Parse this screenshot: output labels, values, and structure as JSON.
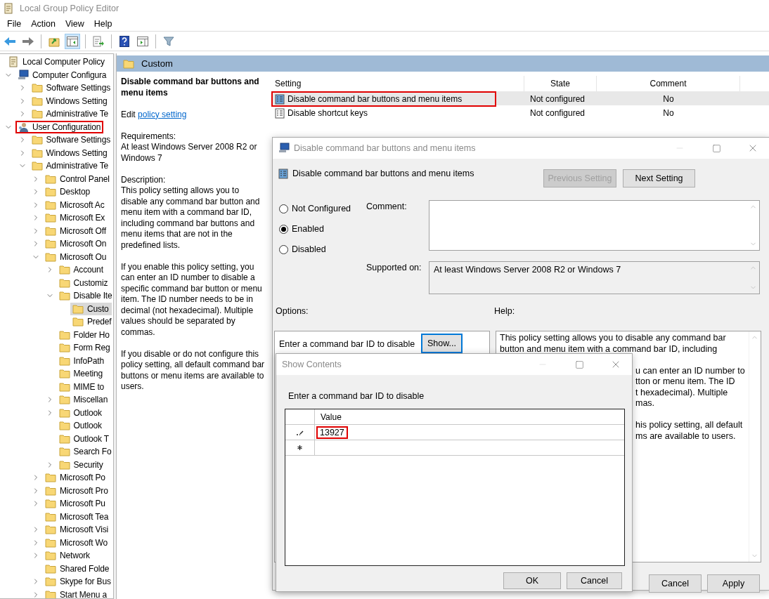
{
  "window": {
    "title": "Local Group Policy Editor"
  },
  "menu": [
    "File",
    "Action",
    "View",
    "Help"
  ],
  "toolbar": [
    {
      "kind": "back",
      "pressed": false
    },
    {
      "kind": "forward",
      "pressed": false
    },
    {
      "kind": "separator"
    },
    {
      "kind": "up",
      "pressed": false
    },
    {
      "kind": "tree",
      "pressed": true
    },
    {
      "kind": "separator"
    },
    {
      "kind": "export",
      "pressed": false
    },
    {
      "kind": "separator"
    },
    {
      "kind": "help",
      "pressed": false
    },
    {
      "kind": "properties",
      "pressed": false
    },
    {
      "kind": "separator"
    },
    {
      "kind": "filter",
      "pressed": false
    }
  ],
  "tree": [
    {
      "label": "Local Computer Policy",
      "kind": "policy",
      "selected": false,
      "highlighted": false,
      "children": [
        {
          "label": "Computer Configura",
          "kind": "computer",
          "expandable": true,
          "expanded": true,
          "selected": false,
          "highlighted": false,
          "children": [
            {
              "label": "Software Settings",
              "kind": "folder",
              "expandable": true,
              "expanded": false,
              "selected": false,
              "highlighted": false
            },
            {
              "label": "Windows Setting",
              "kind": "folder",
              "expandable": true,
              "expanded": false,
              "selected": false,
              "highlighted": false
            },
            {
              "label": "Administrative Te",
              "kind": "folder",
              "expandable": true,
              "expanded": false,
              "selected": false,
              "highlighted": false
            }
          ]
        },
        {
          "label": "User Configuration",
          "kind": "user",
          "expandable": true,
          "expanded": true,
          "selected": false,
          "highlighted": true,
          "children": [
            {
              "label": "Software Settings",
              "kind": "folder",
              "expandable": true,
              "expanded": false,
              "selected": false,
              "highlighted": false
            },
            {
              "label": "Windows Setting",
              "kind": "folder",
              "expandable": true,
              "expanded": false,
              "selected": false,
              "highlighted": false
            },
            {
              "label": "Administrative Te",
              "kind": "folder",
              "expandable": true,
              "expanded": true,
              "selected": false,
              "highlighted": false,
              "children": [
                {
                  "label": "Control Panel",
                  "kind": "folder",
                  "expandable": true,
                  "expanded": false,
                  "selected": false,
                  "highlighted": false
                },
                {
                  "label": "Desktop",
                  "kind": "folder",
                  "expandable": true,
                  "expanded": false,
                  "selected": false,
                  "highlighted": false
                },
                {
                  "label": "Microsoft Ac",
                  "kind": "folder",
                  "expandable": true,
                  "expanded": false,
                  "selected": false,
                  "highlighted": false
                },
                {
                  "label": "Microsoft Ex",
                  "kind": "folder",
                  "expandable": true,
                  "expanded": false,
                  "selected": false,
                  "highlighted": false
                },
                {
                  "label": "Microsoft Off",
                  "kind": "folder",
                  "expandable": true,
                  "expanded": false,
                  "selected": false,
                  "highlighted": false
                },
                {
                  "label": "Microsoft On",
                  "kind": "folder",
                  "expandable": true,
                  "expanded": false,
                  "selected": false,
                  "highlighted": false
                },
                {
                  "label": "Microsoft Ou",
                  "kind": "folder",
                  "expandable": true,
                  "expanded": true,
                  "selected": false,
                  "highlighted": false,
                  "children": [
                    {
                      "label": "Account",
                      "kind": "folder",
                      "expandable": true,
                      "expanded": false,
                      "selected": false,
                      "highlighted": false
                    },
                    {
                      "label": "Customiz",
                      "kind": "folder",
                      "expandable": false,
                      "expanded": false,
                      "selected": false,
                      "highlighted": false
                    },
                    {
                      "label": "Disable Ite",
                      "kind": "folder",
                      "expandable": true,
                      "expanded": true,
                      "selected": false,
                      "highlighted": false,
                      "children": [
                        {
                          "label": "Custo",
                          "kind": "folder",
                          "expandable": false,
                          "expanded": false,
                          "selected": true,
                          "highlighted": false
                        },
                        {
                          "label": "Predef",
                          "kind": "folder",
                          "expandable": false,
                          "expanded": false,
                          "selected": false,
                          "highlighted": false
                        }
                      ]
                    },
                    {
                      "label": "Folder Ho",
                      "kind": "folder",
                      "expandable": false,
                      "expanded": false,
                      "selected": false,
                      "highlighted": false
                    },
                    {
                      "label": "Form Reg",
                      "kind": "folder",
                      "expandable": false,
                      "expanded": false,
                      "selected": false,
                      "highlighted": false
                    },
                    {
                      "label": "InfoPath",
                      "kind": "folder",
                      "expandable": false,
                      "expanded": false,
                      "selected": false,
                      "highlighted": false
                    },
                    {
                      "label": "Meeting",
                      "kind": "folder",
                      "expandable": false,
                      "expanded": false,
                      "selected": false,
                      "highlighted": false
                    },
                    {
                      "label": "MIME to",
                      "kind": "folder",
                      "expandable": false,
                      "expanded": false,
                      "selected": false,
                      "highlighted": false
                    },
                    {
                      "label": "Miscellan",
                      "kind": "folder",
                      "expandable": true,
                      "expanded": false,
                      "selected": false,
                      "highlighted": false
                    },
                    {
                      "label": "Outlook",
                      "kind": "folder",
                      "expandable": true,
                      "expanded": false,
                      "selected": false,
                      "highlighted": false
                    },
                    {
                      "label": "Outlook",
                      "kind": "folder",
                      "expandable": false,
                      "expanded": false,
                      "selected": false,
                      "highlighted": false
                    },
                    {
                      "label": "Outlook T",
                      "kind": "folder",
                      "expandable": false,
                      "expanded": false,
                      "selected": false,
                      "highlighted": false
                    },
                    {
                      "label": "Search Fo",
                      "kind": "folder",
                      "expandable": false,
                      "expanded": false,
                      "selected": false,
                      "highlighted": false
                    },
                    {
                      "label": "Security",
                      "kind": "folder",
                      "expandable": true,
                      "expanded": false,
                      "selected": false,
                      "highlighted": false
                    }
                  ]
                },
                {
                  "label": "Microsoft Po",
                  "kind": "folder",
                  "expandable": true,
                  "expanded": false,
                  "selected": false,
                  "highlighted": false
                },
                {
                  "label": "Microsoft Pro",
                  "kind": "folder",
                  "expandable": true,
                  "expanded": false,
                  "selected": false,
                  "highlighted": false
                },
                {
                  "label": "Microsoft Pu",
                  "kind": "folder",
                  "expandable": true,
                  "expanded": false,
                  "selected": false,
                  "highlighted": false
                },
                {
                  "label": "Microsoft Tea",
                  "kind": "folder",
                  "expandable": false,
                  "expanded": false,
                  "selected": false,
                  "highlighted": false
                },
                {
                  "label": "Microsoft Visi",
                  "kind": "folder",
                  "expandable": true,
                  "expanded": false,
                  "selected": false,
                  "highlighted": false
                },
                {
                  "label": "Microsoft Wo",
                  "kind": "folder",
                  "expandable": true,
                  "expanded": false,
                  "selected": false,
                  "highlighted": false
                },
                {
                  "label": "Network",
                  "kind": "folder",
                  "expandable": true,
                  "expanded": false,
                  "selected": false,
                  "highlighted": false
                },
                {
                  "label": "Shared Folde",
                  "kind": "folder",
                  "expandable": false,
                  "expanded": false,
                  "selected": false,
                  "highlighted": false
                },
                {
                  "label": "Skype for Bus",
                  "kind": "folder",
                  "expandable": true,
                  "expanded": false,
                  "selected": false,
                  "highlighted": false
                },
                {
                  "label": "Start Menu a",
                  "kind": "folder",
                  "expandable": true,
                  "expanded": false,
                  "selected": false,
                  "highlighted": false
                }
              ]
            }
          ]
        }
      ]
    }
  ],
  "details": {
    "header": "Custom",
    "title": "Disable command bar buttons and menu items",
    "edit_prefix": "Edit",
    "edit_link": "policy setting",
    "requirements_label": "Requirements:",
    "requirements": "At least Windows Server 2008 R2 or Windows 7",
    "description_label": "Description:",
    "paragraphs": [
      "This policy setting allows you to disable any command bar button and menu item with a command bar ID, including command bar buttons and menu items that are not in the predefined lists.",
      "If you enable this policy setting, you can enter an ID number to disable a specific command bar button or menu item.  The ID number needs to be in decimal (not hexadecimal). Multiple values should be separated by commas.",
      "If you disable or do not configure this policy setting, all default command bar buttons or menu items are available to users."
    ]
  },
  "settings_table": {
    "columns": [
      "Setting",
      "State",
      "Comment"
    ],
    "rows": [
      {
        "setting": "Disable command bar buttons and menu items",
        "state": "Not configured",
        "comment": "No",
        "selected": true,
        "highlighted": true
      },
      {
        "setting": "Disable shortcut keys",
        "state": "Not configured",
        "comment": "No",
        "selected": false,
        "highlighted": false
      }
    ]
  },
  "policy_dialog": {
    "title": "Disable command bar buttons and menu items",
    "heading": "Disable command bar buttons and menu items",
    "nav_buttons": [
      {
        "label": "Previous Setting",
        "disabled": true
      },
      {
        "label": "Next Setting",
        "disabled": false
      }
    ],
    "states": [
      {
        "label": "Not Configured",
        "selected": false
      },
      {
        "label": "Enabled",
        "selected": true
      },
      {
        "label": "Disabled",
        "selected": false
      }
    ],
    "comment_label": "Comment:",
    "supported_label": "Supported on:",
    "supported_value": "At least Windows Server 2008 R2 or Windows 7",
    "options_label": "Options:",
    "help_label": "Help:",
    "option_label": "Enter a command bar ID to disable",
    "option_button": {
      "label": "Show...",
      "focused": true
    },
    "help_top_lines": [
      "This policy setting allows you to disable any command bar",
      "button and menu item with a command bar ID, including"
    ],
    "help_fragments": [
      [
        "u can enter an ID number to",
        "tton or menu item.  The ID",
        "t hexadecimal).  Multiple",
        "mas."
      ],
      [
        "his policy setting, all default",
        "ms are available to users."
      ]
    ],
    "footer_buttons": [
      "Cancel",
      "Apply"
    ]
  },
  "show_contents": {
    "title": "Show Contents",
    "prompt": "Enter a command bar ID to disable",
    "column": "Value",
    "rows": [
      {
        "kind": "edit",
        "value": "13927",
        "highlighted": true
      },
      {
        "kind": "new",
        "highlighted": false
      }
    ],
    "buttons": [
      "OK",
      "Cancel"
    ]
  }
}
